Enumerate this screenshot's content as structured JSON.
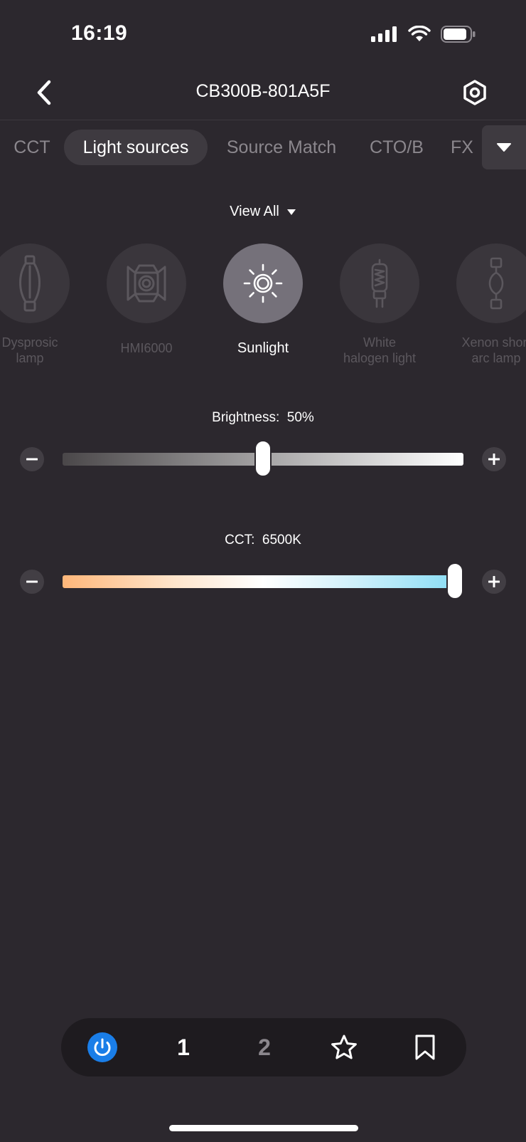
{
  "status_bar": {
    "time": "16:19",
    "icons": [
      "cellular-signal-icon",
      "wifi-icon",
      "battery-icon"
    ]
  },
  "nav": {
    "back_icon": "chevron-left-icon",
    "title": "CB300B-801A5F",
    "settings_icon": "hexagon-settings-icon"
  },
  "tabs": {
    "items": [
      {
        "label": "CCT",
        "active": false
      },
      {
        "label": "Light sources",
        "active": true
      },
      {
        "label": "Source Match",
        "active": false
      },
      {
        "label": "CTO/B",
        "active": false
      },
      {
        "label": "FX",
        "active": false
      }
    ],
    "dropdown_icon": "triangle-down-icon"
  },
  "filter": {
    "label": "View All",
    "icon": "triangle-down-icon"
  },
  "sources": [
    {
      "label": "Dysprosic\nlamp",
      "icon": "dysprosic-lamp-icon",
      "active": false
    },
    {
      "label": "HMI6000",
      "icon": "hmi-fixture-icon",
      "active": false
    },
    {
      "label": "Sunlight",
      "icon": "sun-icon",
      "active": true
    },
    {
      "label": "White\nhalogen light",
      "icon": "halogen-bulb-icon",
      "active": false
    },
    {
      "label": "Xenon short\narc lamp",
      "icon": "xenon-lamp-icon",
      "active": false
    }
  ],
  "brightness": {
    "label": "Brightness:",
    "value_text": "50%",
    "value": 0.5,
    "minus_icon": "minus-icon",
    "plus_icon": "plus-icon"
  },
  "cct": {
    "label": "CCT:",
    "value_text": "6500K",
    "value": 1.0,
    "minus_icon": "minus-icon",
    "plus_icon": "plus-icon"
  },
  "bottom_bar": {
    "power_icon": "power-icon",
    "preset_1": "1",
    "preset_2": "2",
    "favorite_icon": "star-icon",
    "bookmark_icon": "bookmark-icon"
  },
  "colors": {
    "background": "#2c282e",
    "accent_blue": "#1a7ee8",
    "cct_warm": "#ffb77a",
    "cct_cool": "#86dcf5"
  }
}
